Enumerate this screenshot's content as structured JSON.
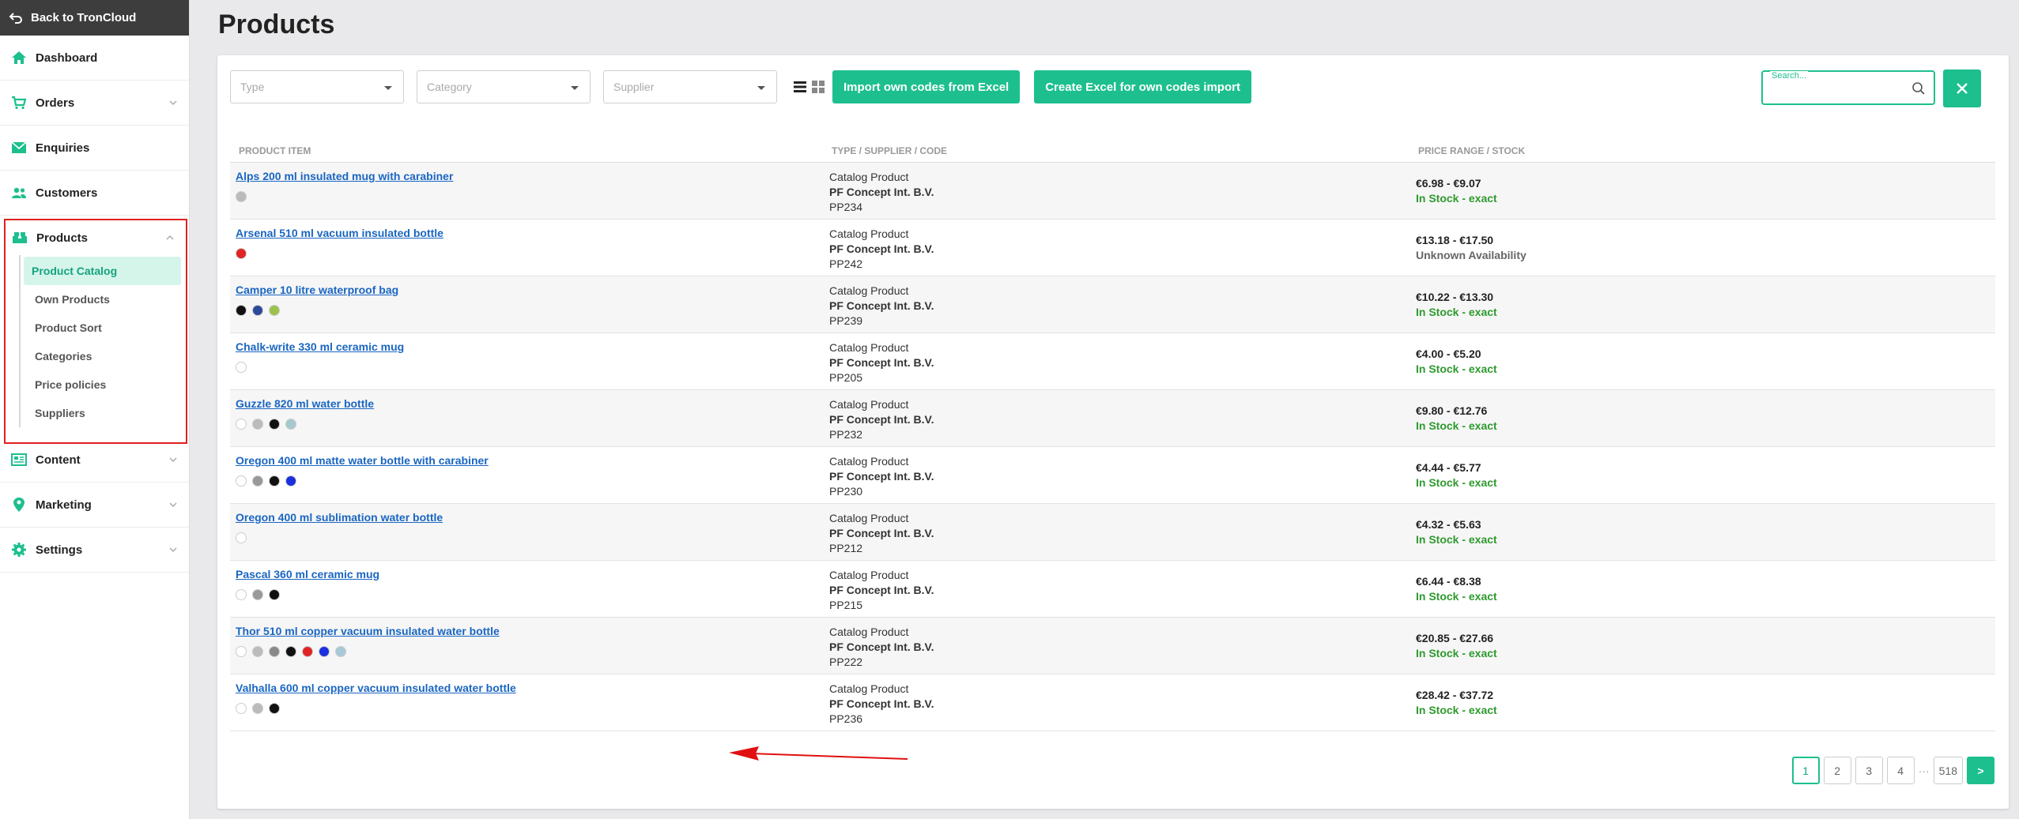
{
  "sidebar": {
    "back_label": "Back to TronCloud",
    "items": [
      {
        "label": "Dashboard"
      },
      {
        "label": "Orders"
      },
      {
        "label": "Enquiries"
      },
      {
        "label": "Customers"
      },
      {
        "label": "Products"
      },
      {
        "label": "Content"
      },
      {
        "label": "Marketing"
      },
      {
        "label": "Settings"
      }
    ],
    "products_sub": [
      "Product Catalog",
      "Own Products",
      "Product Sort",
      "Categories",
      "Price policies",
      "Suppliers"
    ],
    "accent_color": "#1dbf8e"
  },
  "page": {
    "title": "Products"
  },
  "toolbar": {
    "type_placeholder": "Type",
    "category_placeholder": "Category",
    "supplier_placeholder": "Supplier",
    "import_button": "Import own codes from Excel",
    "create_button": "Create Excel for own codes import",
    "search_label": "Search..."
  },
  "table": {
    "headers": [
      "PRODUCT ITEM",
      "TYPE / SUPPLIER / CODE",
      "PRICE RANGE / STOCK"
    ],
    "rows": [
      {
        "name": "Alps 200 ml insulated mug with carabiner",
        "colors": [
          "#bbbbbb"
        ],
        "type": "Catalog Product",
        "supplier": "PF Concept Int. B.V.",
        "code": "PP234",
        "price": "€6.98 - €9.07",
        "stock": "In Stock - exact"
      },
      {
        "name": "Arsenal 510 ml vacuum insulated bottle",
        "colors": [
          "#e02424"
        ],
        "type": "Catalog Product",
        "supplier": "PF Concept Int. B.V.",
        "code": "PP242",
        "price": "€13.18 - €17.50",
        "stock": "Unknown Availability"
      },
      {
        "name": "Camper 10 litre waterproof bag",
        "colors": [
          "#111111",
          "#2c4a9a",
          "#9bc24a"
        ],
        "type": "Catalog Product",
        "supplier": "PF Concept Int. B.V.",
        "code": "PP239",
        "price": "€10.22 - €13.30",
        "stock": "In Stock - exact"
      },
      {
        "name": "Chalk-write 330 ml ceramic mug",
        "colors": [
          "#ffffff"
        ],
        "type": "Catalog Product",
        "supplier": "PF Concept Int. B.V.",
        "code": "PP205",
        "price": "€4.00 - €5.20",
        "stock": "In Stock - exact"
      },
      {
        "name": "Guzzle 820 ml water bottle",
        "colors": [
          "#ffffff",
          "#bbbbbb",
          "#111111",
          "#a8c8d0"
        ],
        "type": "Catalog Product",
        "supplier": "PF Concept Int. B.V.",
        "code": "PP232",
        "price": "€9.80 - €12.76",
        "stock": "In Stock - exact"
      },
      {
        "name": "Oregon 400 ml matte water bottle with carabiner",
        "colors": [
          "#ffffff",
          "#999999",
          "#111111",
          "#1a2fe0"
        ],
        "type": "Catalog Product",
        "supplier": "PF Concept Int. B.V.",
        "code": "PP230",
        "price": "€4.44 - €5.77",
        "stock": "In Stock - exact"
      },
      {
        "name": "Oregon 400 ml sublimation water bottle",
        "colors": [
          "#ffffff"
        ],
        "type": "Catalog Product",
        "supplier": "PF Concept Int. B.V.",
        "code": "PP212",
        "price": "€4.32 - €5.63",
        "stock": "In Stock - exact"
      },
      {
        "name": "Pascal 360 ml ceramic mug",
        "colors": [
          "#ffffff",
          "#999999",
          "#111111"
        ],
        "type": "Catalog Product",
        "supplier": "PF Concept Int. B.V.",
        "code": "PP215",
        "price": "€6.44 - €8.38",
        "stock": "In Stock - exact"
      },
      {
        "name": "Thor 510 ml copper vacuum insulated water bottle",
        "colors": [
          "#ffffff",
          "#bbbbbb",
          "#888888",
          "#111111",
          "#e02424",
          "#1a2fe0",
          "#a8c8d8"
        ],
        "type": "Catalog Product",
        "supplier": "PF Concept Int. B.V.",
        "code": "PP222",
        "price": "€20.85 - €27.66",
        "stock": "In Stock - exact"
      },
      {
        "name": "Valhalla 600 ml copper vacuum insulated water bottle",
        "colors": [
          "#ffffff",
          "#bbbbbb",
          "#111111"
        ],
        "type": "Catalog Product",
        "supplier": "PF Concept Int. B.V.",
        "code": "PP236",
        "price": "€28.42 - €37.72",
        "stock": "In Stock - exact"
      }
    ]
  },
  "pagination": {
    "pages": [
      "1",
      "2",
      "3",
      "4"
    ],
    "ellipsis": "···",
    "last": "518",
    "next": ">"
  }
}
